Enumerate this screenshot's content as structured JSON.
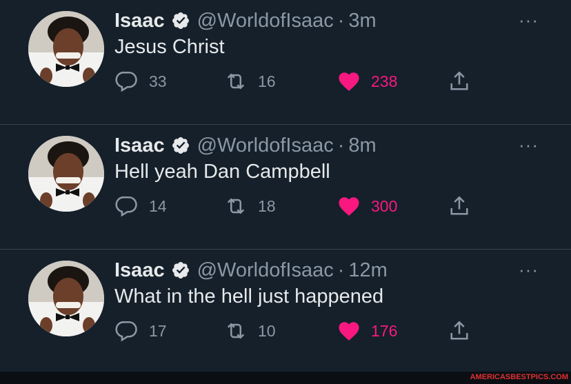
{
  "tweets": [
    {
      "name": "Isaac",
      "handle": "@WorldofIsaac",
      "separator": "·",
      "time": "3m",
      "text": "Jesus Christ",
      "replies": "33",
      "retweets": "16",
      "likes": "238"
    },
    {
      "name": "Isaac",
      "handle": "@WorldofIsaac",
      "separator": "·",
      "time": "8m",
      "text": "Hell yeah Dan Campbell",
      "replies": "14",
      "retweets": "18",
      "likes": "300"
    },
    {
      "name": "Isaac",
      "handle": "@WorldofIsaac",
      "separator": "·",
      "time": "12m",
      "text": "What in the hell just happened",
      "replies": "17",
      "retweets": "10",
      "likes": "176"
    }
  ],
  "more_label": "···",
  "watermark": "AMERICASBESTPICS.COM",
  "colors": {
    "background": "#15202b",
    "muted": "#8b98a5",
    "like": "#f91880",
    "divider": "#38444d"
  },
  "icons": [
    "reply-icon",
    "retweet-icon",
    "heart-icon",
    "share-icon",
    "verified-badge-icon",
    "more-icon"
  ]
}
